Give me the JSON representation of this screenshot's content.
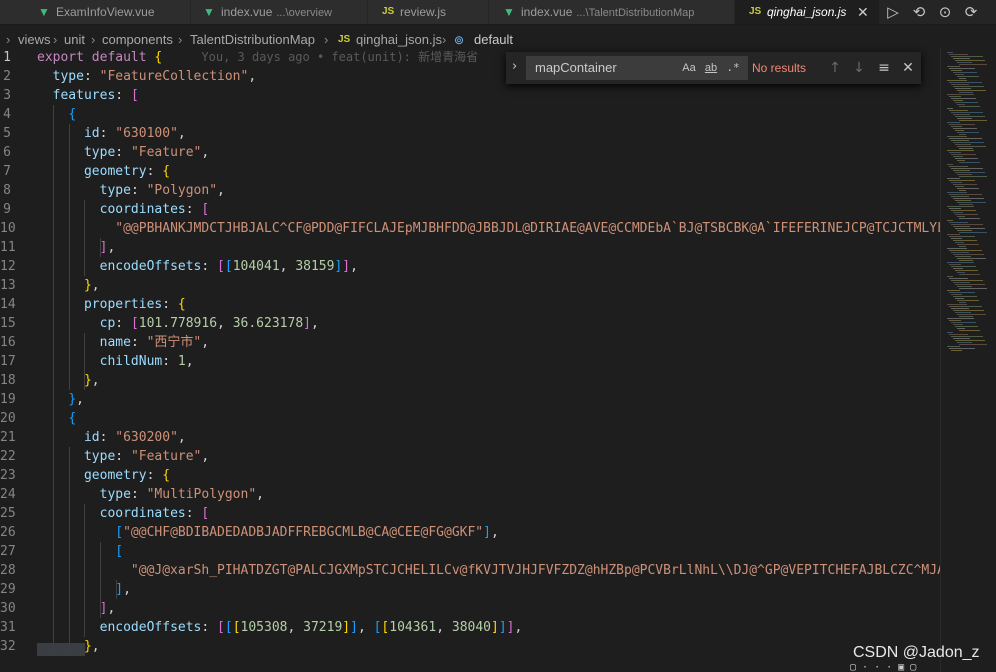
{
  "tabs": [
    {
      "icon": "vue-icon",
      "name": "ExamInfoView.vue",
      "path": ""
    },
    {
      "icon": "vue-icon",
      "name": "index.vue",
      "path": "...\\overview"
    },
    {
      "icon": "js-icon",
      "name": "review.js",
      "path": ""
    },
    {
      "icon": "vue-icon",
      "name": "index.vue",
      "path": "...\\TalentDistributionMap"
    },
    {
      "icon": "js-icon",
      "name": "qinghai_json.js",
      "path": "",
      "active": true
    }
  ],
  "tab_actions": [
    "run-icon",
    "go-back-icon",
    "go-forward-icon",
    "compare-icon"
  ],
  "breadcrumb": {
    "items": [
      "views",
      "unit",
      "components",
      "TalentDistributionMap"
    ],
    "file_icon": "JS",
    "file": "qinghai_json.js",
    "symbol": "default"
  },
  "editor": {
    "blame": "You, 3 days ago • feat(unit): 新增青海省",
    "line_numbers": [
      "1",
      "2",
      "3",
      "4",
      "5",
      "6",
      "7",
      "8",
      "9",
      "10",
      "11",
      "12",
      "13",
      "14",
      "15",
      "16",
      "17",
      "18",
      "19",
      "20",
      "21",
      "22",
      "23",
      "24",
      "25",
      "26",
      "27",
      "28",
      "29",
      "30",
      "31",
      "32"
    ],
    "code": {
      "l1_export": "export",
      "l1_default": "default",
      "l2_key": "type",
      "l2_val": "\"FeatureCollection\"",
      "l3_key": "features",
      "l5_key": "id",
      "l5_val": "\"630100\"",
      "l6_key": "type",
      "l6_val": "\"Feature\"",
      "l7_key": "geometry",
      "l8_key": "type",
      "l8_val": "\"Polygon\"",
      "l9_key": "coordinates",
      "l10_val": "\"@@PBHANKJMDCTJHBJALC^CF@PDD@FIFCLAJEpMJBHFDD@JBBJDL@DIRIAE@AVE@CCMDEbA`BJ@TSBCBK@A`IFEFERINEJCP@TCJCTMLYLE",
      "l12_key": "encodeOffsets",
      "l12_n1": "104041",
      "l12_n2": "38159",
      "l14_key": "properties",
      "l15_key": "cp",
      "l15_n1": "101.778916",
      "l15_n2": "36.623178",
      "l16_key": "name",
      "l16_val": "\"西宁市\"",
      "l17_key": "childNum",
      "l17_n": "1",
      "l21_key": "id",
      "l21_val": "\"630200\"",
      "l22_key": "type",
      "l22_val": "\"Feature\"",
      "l23_key": "geometry",
      "l24_key": "type",
      "l24_val": "\"MultiPolygon\"",
      "l25_key": "coordinates",
      "l26_val": "\"@@CHF@BDIBADEDADBJADFFREBGCMLB@CA@CEE@FG@GKF\"",
      "l28_val": "\"@@J@xarSh_PIHATDZGT@PALCJGXMpSTCJCHELILCv@fKVJTVJHJFVFZDZ@hHZBp@PCVBrLlNhL\\\\DJ@^GP@VEPITCHEFAJBLCZC^MJAF(",
      "l31_key": "encodeOffsets",
      "l31_n1": "105308",
      "l31_n2": "37219",
      "l31_n3": "104361",
      "l31_n4": "38040"
    }
  },
  "find_widget": {
    "toggle_icon": "chevron-right-icon",
    "query": "mapContainer",
    "match_case": "Aa",
    "whole_word": "ab",
    "regex": ".*",
    "result": "No results",
    "buttons": [
      "arrow-up-icon",
      "arrow-down-icon",
      "find-in-selection-icon",
      "close-icon"
    ]
  },
  "watermark": "CSDN @Jadon_z",
  "colors": {
    "keyword": "#569cd6",
    "control": "#c586c0",
    "property": "#9cdcfe",
    "string": "#ce9178",
    "number": "#b5cea8",
    "bracket1": "#ffd700",
    "bracket2": "#da70d6",
    "bracket3": "#179fff",
    "no_results": "#f48771"
  }
}
